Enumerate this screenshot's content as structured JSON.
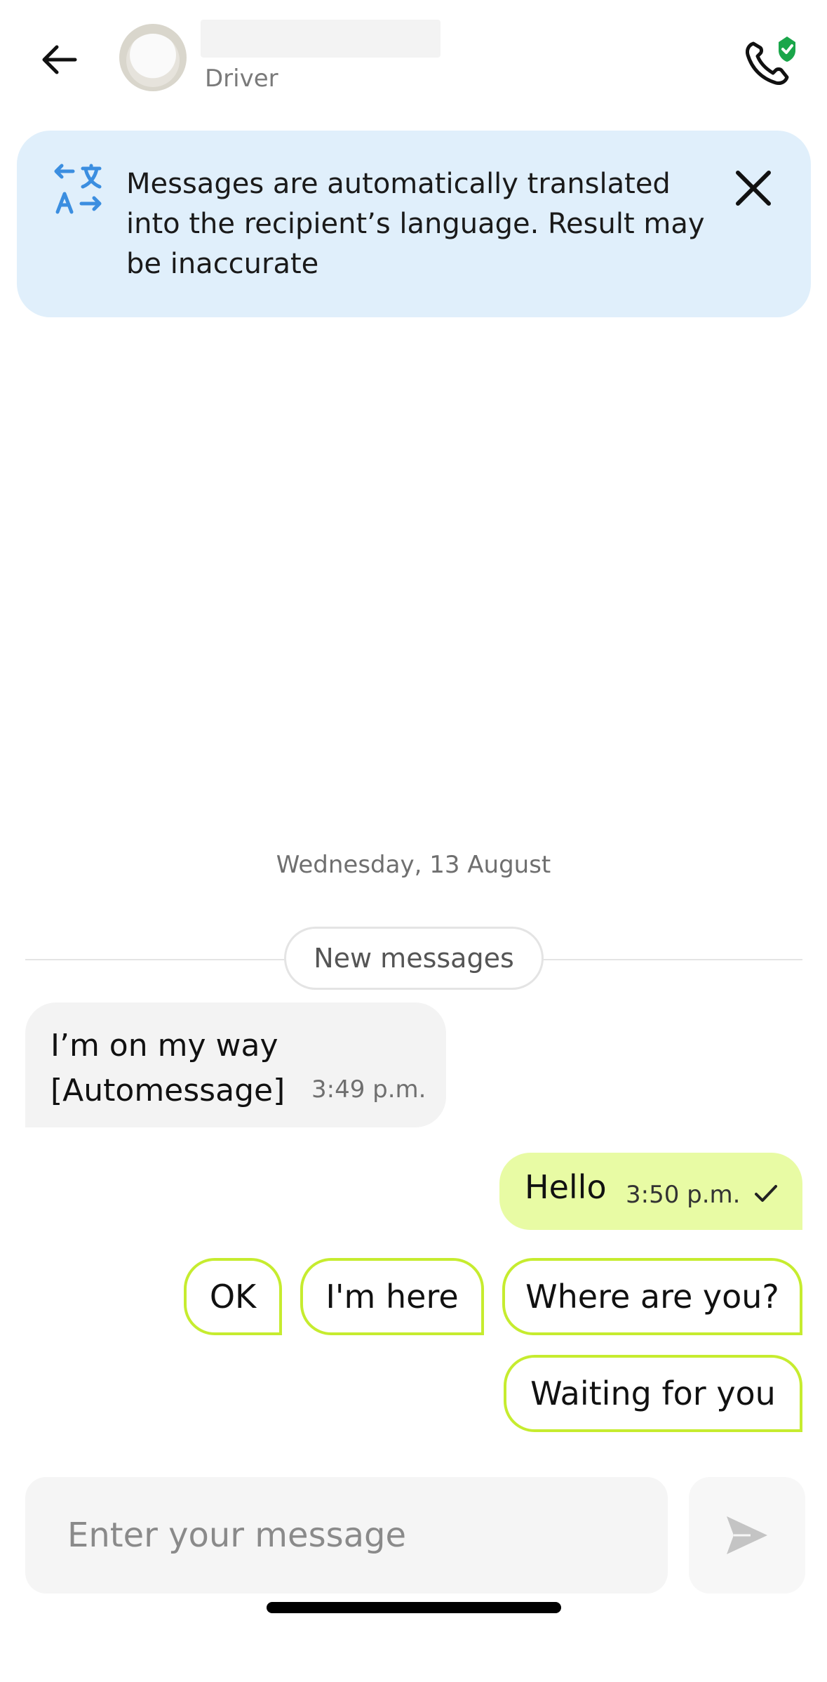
{
  "header": {
    "role": "Driver",
    "back_icon": "arrow-left-icon",
    "call_icon": "phone-verified-icon",
    "call_badge_color": "#1aa64a"
  },
  "banner": {
    "text": "Messages are automatically translated into the recipient’s language. Result may be inaccurate",
    "icon": "translate-icon",
    "icon_color": "#3b8ee0",
    "background": "#e0effb"
  },
  "chat": {
    "date": "Wednesday, 13 August",
    "new_messages_label": "New messages",
    "messages": [
      {
        "direction": "incoming",
        "text": "I’m on my way\n[Automessage]",
        "time": "3:49 p.m."
      },
      {
        "direction": "outgoing",
        "text": "Hello",
        "time": "3:50 p.m.",
        "status": "sent"
      }
    ],
    "outgoing_color": "#e8fba4"
  },
  "quick_replies": [
    "OK",
    "I'm here",
    "Where are you?",
    "Waiting for you"
  ],
  "quick_reply_border_color": "#c6ec2f",
  "composer": {
    "placeholder": "Enter your message",
    "send_icon": "send-icon"
  }
}
